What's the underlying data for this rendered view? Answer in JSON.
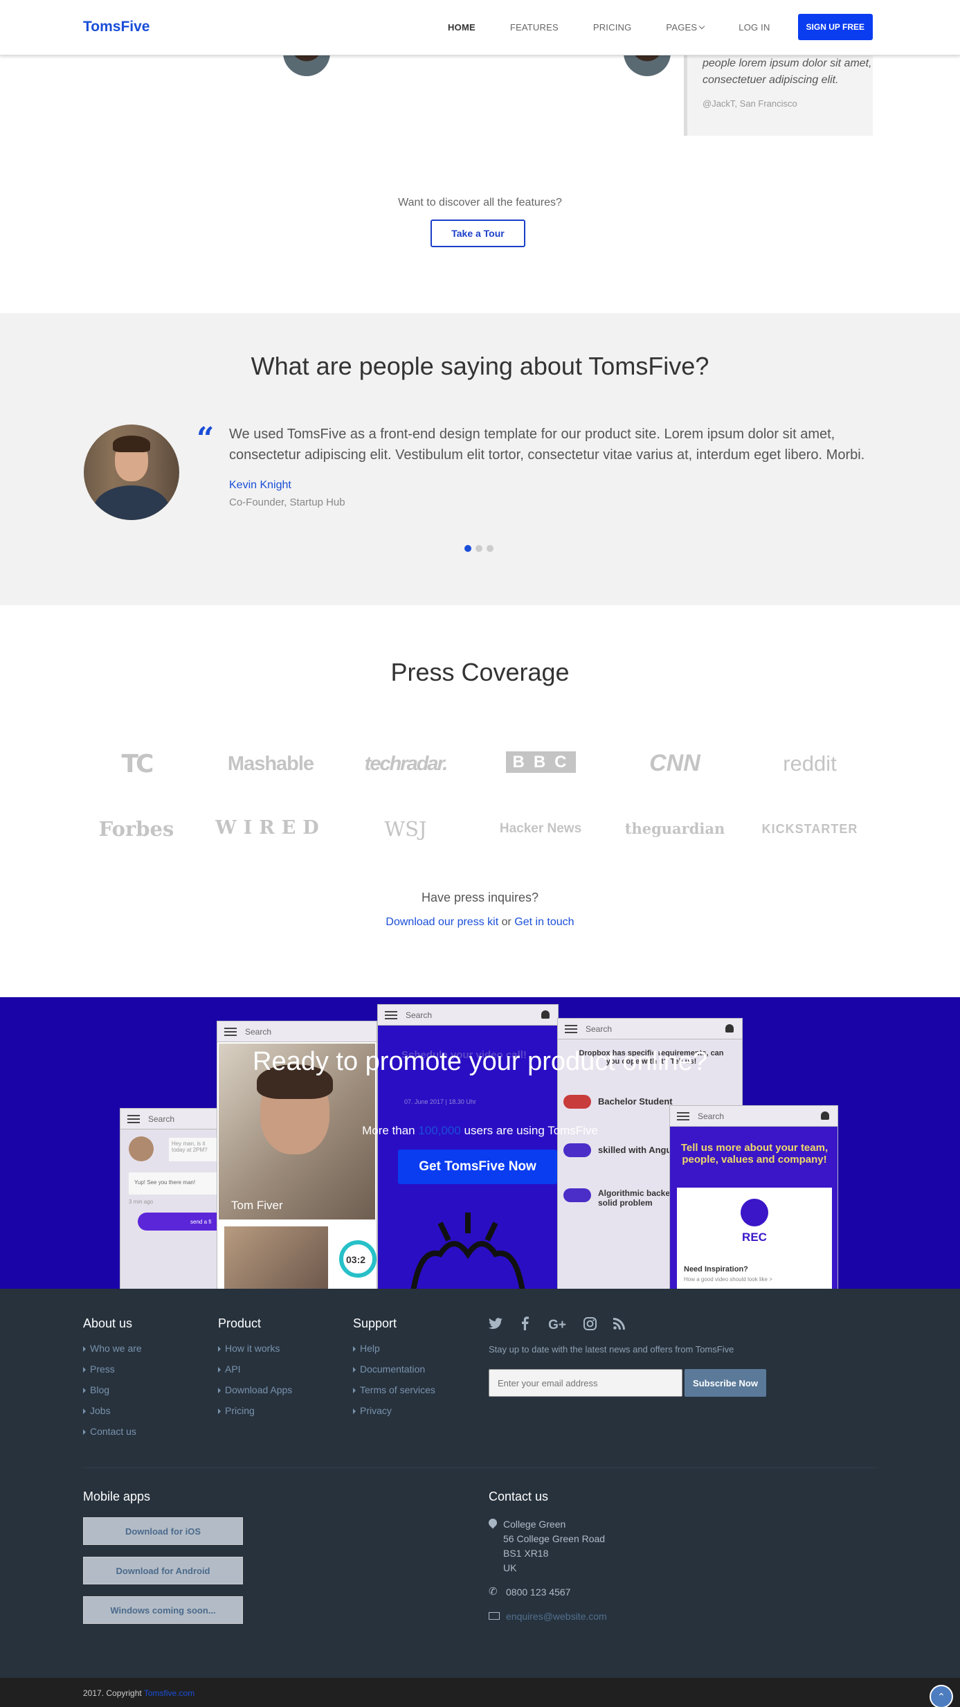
{
  "nav": {
    "brand": "TomsFive",
    "links": [
      "HOME",
      "FEATURES",
      "PRICING",
      "PAGES",
      "LOG IN"
    ],
    "signup": "SIGN UP FREE"
  },
  "top_quote": {
    "text": "people lorem ipsum dolor sit amet, consectetuer adipiscing elit.",
    "author": "@JackT, San Francisco"
  },
  "discover": {
    "text": "Want to discover all the features?",
    "button": "Take a Tour"
  },
  "testimonials": {
    "title": "What are people saying about TomsFive?",
    "quote": "We used TomsFive as a front-end design template for our product site. Lorem ipsum dolor sit amet, consectetur adipiscing elit. Vestibulum elit tortor, consectetur vitae varius at, interdum eget libero. Morbi.",
    "name": "Kevin Knight",
    "role": "Co-Founder, Startup Hub",
    "dots": 3,
    "active_dot": 0
  },
  "press": {
    "title": "Press Coverage",
    "logos": [
      "TC",
      "Mashable",
      "techradar.",
      "BBC",
      "CNN",
      "reddit",
      "Forbes",
      "WIRED",
      "WSJ",
      "Hacker News",
      "theguardian",
      "KICKSTARTER"
    ],
    "ask": "Have press inquires?",
    "kit_link": "Download our press kit",
    "or": "or",
    "touch_link": "Get in touch"
  },
  "cta": {
    "title": "Ready to promote your product online?",
    "sub_before": "More than",
    "sub_number": "100,000",
    "sub_after": "users are using TomsFive",
    "button": "Get TomsFive Now",
    "phone_search": "Search",
    "phone_texts": {
      "video_call": "Schedule your video call!",
      "date": "07. June 2017 | 18.30 Uhr",
      "dropbox": "Dropbox has specific requirements, can you cope with it? Tell us!",
      "toggle1": "Bachelor Student",
      "toggle2": "skilled with Angu",
      "toggle3": "Algorithmic backe rock-solid problem",
      "team": "Tell us more about your team, people, values and company!",
      "rec": "REC",
      "inspiration": "Need Inspiration?",
      "inspiration_sub": "How a good video should look like >",
      "name": "Tom Fiver",
      "timer": "03:2",
      "chat1": "Hey man, is it today at 2PM?",
      "chat2": "Yup! See you there man!",
      "ago": "3 min ago",
      "send": "send a fi"
    }
  },
  "footer": {
    "about": {
      "title": "About us",
      "links": [
        "Who we are",
        "Press",
        "Blog",
        "Jobs",
        "Contact us"
      ]
    },
    "product": {
      "title": "Product",
      "links": [
        "How it works",
        "API",
        "Download Apps",
        "Pricing"
      ]
    },
    "support": {
      "title": "Support",
      "links": [
        "Help",
        "Documentation",
        "Terms of services",
        "Privacy"
      ]
    },
    "newsletter": {
      "text": "Stay up to date with the latest news and offers from TomsFive",
      "placeholder": "Enter your email address",
      "button": "Subscribe Now"
    },
    "social_icons": [
      "twitter-icon",
      "facebook-icon",
      "google-plus-icon",
      "instagram-icon",
      "rss-icon"
    ],
    "mobile": {
      "title": "Mobile apps",
      "buttons": [
        "Download for iOS",
        "Download for Android",
        "Windows coming soon..."
      ]
    },
    "contact": {
      "title": "Contact us",
      "address": [
        "College Green",
        "56 College Green Road",
        "BS1 XR18",
        "UK"
      ],
      "phone": "0800 123 4567",
      "email": "enquires@website.com"
    }
  },
  "copyright": {
    "text": "2017. Copyright",
    "link": "Tomsfive.com"
  },
  "colors": {
    "accent": "#1a4ed8",
    "button": "#0a3cf0",
    "cta_bg": "#1a04a8",
    "footer_bg": "#27323d"
  }
}
